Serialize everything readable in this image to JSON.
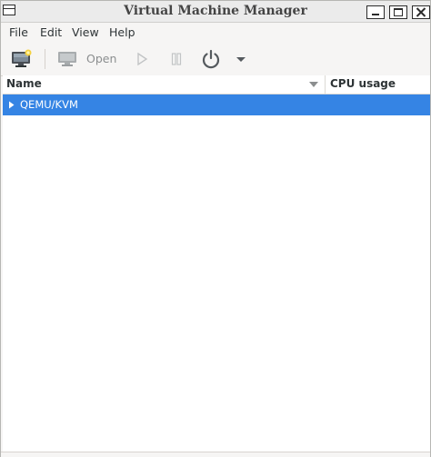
{
  "window": {
    "title": "Virtual Machine Manager"
  },
  "menubar": {
    "items": [
      {
        "label": "File"
      },
      {
        "label": "Edit"
      },
      {
        "label": "View"
      },
      {
        "label": "Help"
      }
    ]
  },
  "toolbar": {
    "new_vm_icon": "monitor-with-star-icon",
    "open_label": "Open",
    "run_icon": "play-icon",
    "pause_icon": "pause-icon",
    "shutdown_icon": "power-icon",
    "shutdown_menu_icon": "dropdown-arrow-icon"
  },
  "list": {
    "columns": [
      {
        "label": "Name"
      },
      {
        "label": "CPU usage"
      }
    ],
    "rows": [
      {
        "label": "QEMU/KVM",
        "selected": true
      }
    ]
  },
  "colors": {
    "selection": "#3584e4",
    "window_bg": "#f6f5f4",
    "disabled_text": "#8b8e8f"
  }
}
